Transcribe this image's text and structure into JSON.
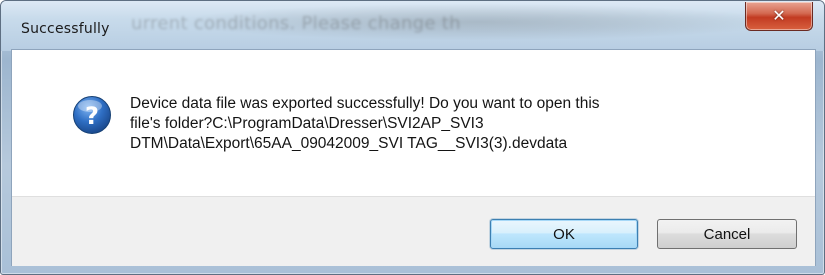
{
  "window": {
    "title": "Successfully",
    "background_hint_text": "urrent conditions. Please change th"
  },
  "titlebar_controls": {
    "close_glyph": "✕"
  },
  "message": {
    "icon": "question-icon",
    "text": "Device data file was exported successfully! Do you want to open this\nfile's folder?C:\\ProgramData\\Dresser\\SVI2AP_SVI3\nDTM\\Data\\Export\\65AA_09042009_SVI TAG__SVI3(3).devdata"
  },
  "buttons": {
    "ok_label": "OK",
    "cancel_label": "Cancel"
  },
  "colors": {
    "close_button": "#c23b22",
    "ok_focus_border": "#3c7fb1",
    "question_icon_blue": "#2f6fc4"
  }
}
